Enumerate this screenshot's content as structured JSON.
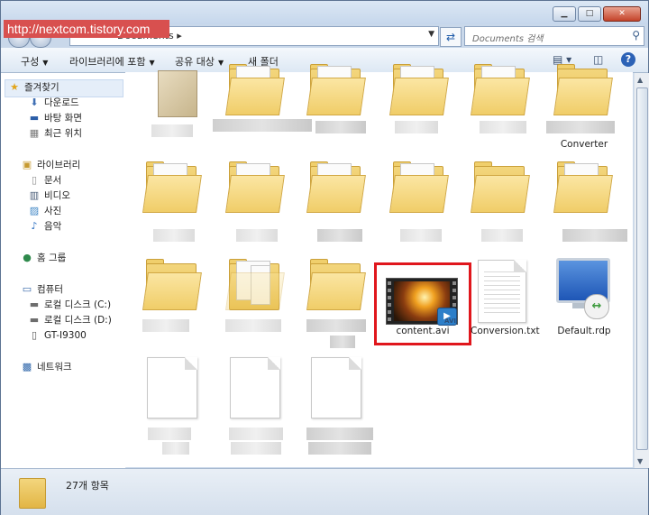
{
  "watermark": "http://nextcom.tistory.com",
  "address": {
    "crumb": "Documents",
    "crumb_sep": "▸"
  },
  "search": {
    "placeholder": "Documents 검색"
  },
  "toolbar": {
    "organize": "구성",
    "include_library": "라이브러리에 포함",
    "share_with": "공유 대상",
    "new_folder": "새 폴더"
  },
  "nav": {
    "favorites": "즐겨찾기",
    "downloads": "다운로드",
    "desktop": "바탕 화면",
    "recent": "최근 위치",
    "libraries": "라이브러리",
    "documents": "문서",
    "videos": "비디오",
    "pictures": "사진",
    "music": "음악",
    "homegroup": "홈 그룹",
    "computer": "컴퓨터",
    "local_c": "로컬 디스크 (C:)",
    "local_d": "로컬 디스크 (D:)",
    "device": "GT-I9300",
    "network": "네트워크"
  },
  "files": {
    "converter": "Converter",
    "content_avi": "content.avi",
    "conversion_txt": "Conversion.txt",
    "default_rdp": "Default.rdp",
    "avi_badge": "AVI"
  },
  "status": {
    "item_count": "27개 항목"
  },
  "colors": {
    "highlight": "#e0161c",
    "folder": "#f0cd68",
    "nav_bg": "#ffffff",
    "chrome": "#c9d8ea"
  }
}
